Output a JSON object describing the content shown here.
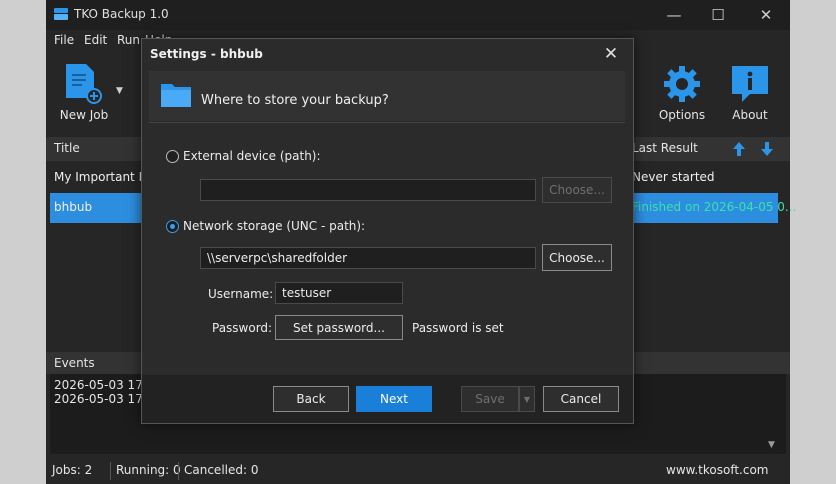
{
  "window": {
    "title": "TKO Backup 1.0",
    "minimize": "—",
    "maximize": "☐",
    "close": "✕"
  },
  "menu": [
    "File",
    "Edit",
    "Run",
    "Help"
  ],
  "toolbar": {
    "new_job": "New Job",
    "options": "Options",
    "about": "About"
  },
  "jobs_table": {
    "col_title": "Title",
    "col_last_result": "Last Result",
    "rows": [
      {
        "title": "My Important Files",
        "last_result": "Never started"
      },
      {
        "title": "bhbub",
        "last_result": "Finished on 2026-04-05 0..."
      }
    ]
  },
  "events": {
    "label": "Events",
    "entries": [
      "2026-05-03 17:25",
      "2026-05-03 17:3"
    ]
  },
  "status": {
    "jobs": "Jobs: 2",
    "running": "Running: 0",
    "cancelled": "Cancelled: 0",
    "website": "www.tkosoft.com"
  },
  "dialog": {
    "title": "Settings - bhbub",
    "heading": "Where to store your backup?",
    "external_label": "External device (path):",
    "external_path": "",
    "external_choose": "Choose...",
    "network_label": "Network storage (UNC - path):",
    "network_path": "\\\\serverpc\\sharedfolder",
    "network_choose": "Choose...",
    "username_label": "Username:",
    "username_value": "testuser",
    "password_label": "Password:",
    "set_password": "Set password...",
    "password_status": "Password is set",
    "back": "Back",
    "next": "Next",
    "save": "Save",
    "cancel": "Cancel",
    "selected_option": "network"
  },
  "colors": {
    "accent": "#1a7fd9",
    "selection": "#2d8ee0",
    "icon_blue": "#2b95ea",
    "finished_text": "#3de0a8"
  }
}
